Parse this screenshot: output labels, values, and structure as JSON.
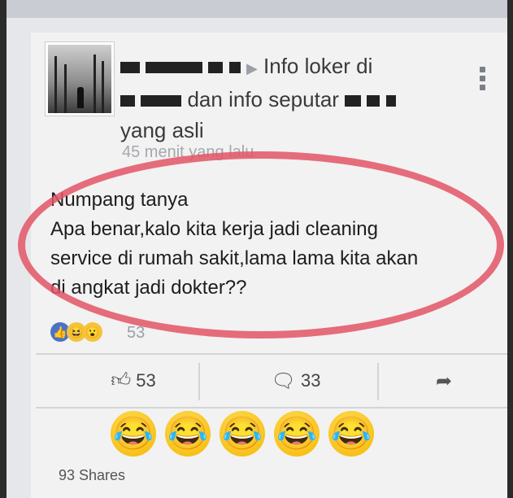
{
  "post": {
    "header_line1_tail": "Info loker di",
    "header_line2_mid": "dan info seputar",
    "header_line3": "yang asli",
    "timestamp": "45 menit yang lalu",
    "body_lines": [
      "Numpang tanya",
      "Apa benar,kalo kita kerja jadi cleaning",
      "service di rumah sakit,lama lama kita akan",
      "di angkat jadi dokter??"
    ],
    "reaction_count": "53"
  },
  "actions": {
    "like_count": "53",
    "comment_count": "33"
  },
  "comment": {
    "emojis": [
      "😂",
      "😂",
      "😂",
      "😂",
      "😂"
    ]
  },
  "shares": "93 Shares",
  "icons": {
    "like": "thumbs-up-icon",
    "comment": "speech-bubble-icon",
    "share": "share-arrow-icon",
    "menu": "more-options-icon"
  },
  "colors": {
    "highlight_ring": "#e35566",
    "like_reaction": "#4a73c8",
    "emoji_yellow": "#f5c33b"
  }
}
